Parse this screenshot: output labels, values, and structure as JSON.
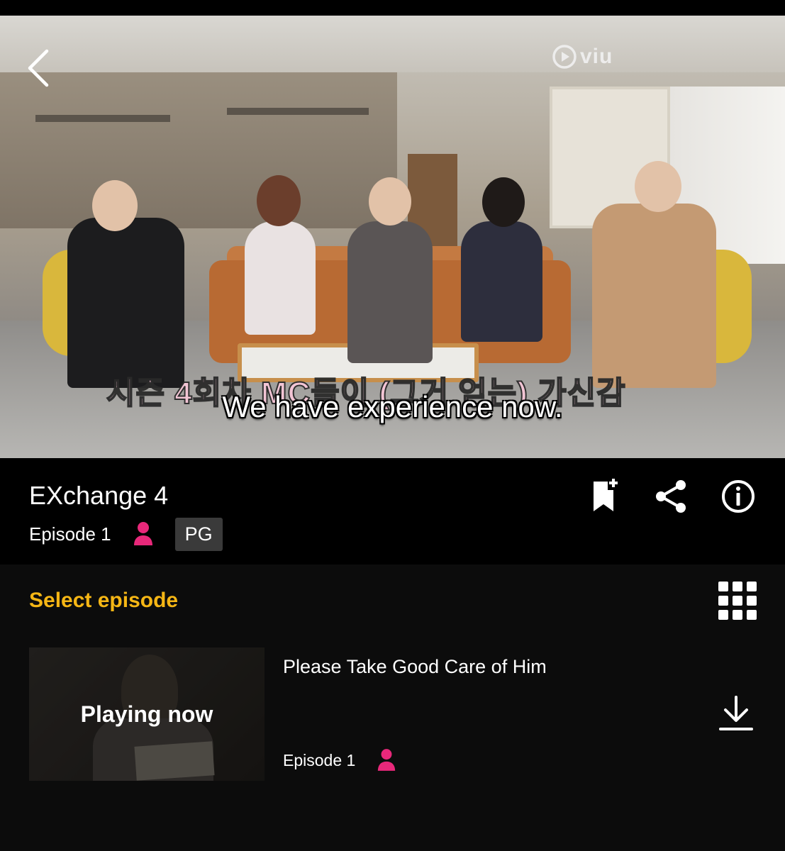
{
  "player": {
    "brand": "viu",
    "burned_caption": "시즌 4회차 MC들이 (그거 얻는) 가신감",
    "subtitle": "We have experience now."
  },
  "show": {
    "title": "EXchange 4",
    "episode_label": "Episode 1",
    "rating": "PG",
    "actions": [
      "bookmark-add-icon",
      "share-icon",
      "info-icon"
    ]
  },
  "episodes": {
    "header": "Select episode",
    "items": [
      {
        "status": "Playing now",
        "title": "Please Take Good Care of Him",
        "episode": "Episode 1"
      }
    ]
  },
  "colors": {
    "accent_yellow": "#f5b615",
    "profile_pink": "#e8287a",
    "rating_bg": "#3a3a3a"
  }
}
